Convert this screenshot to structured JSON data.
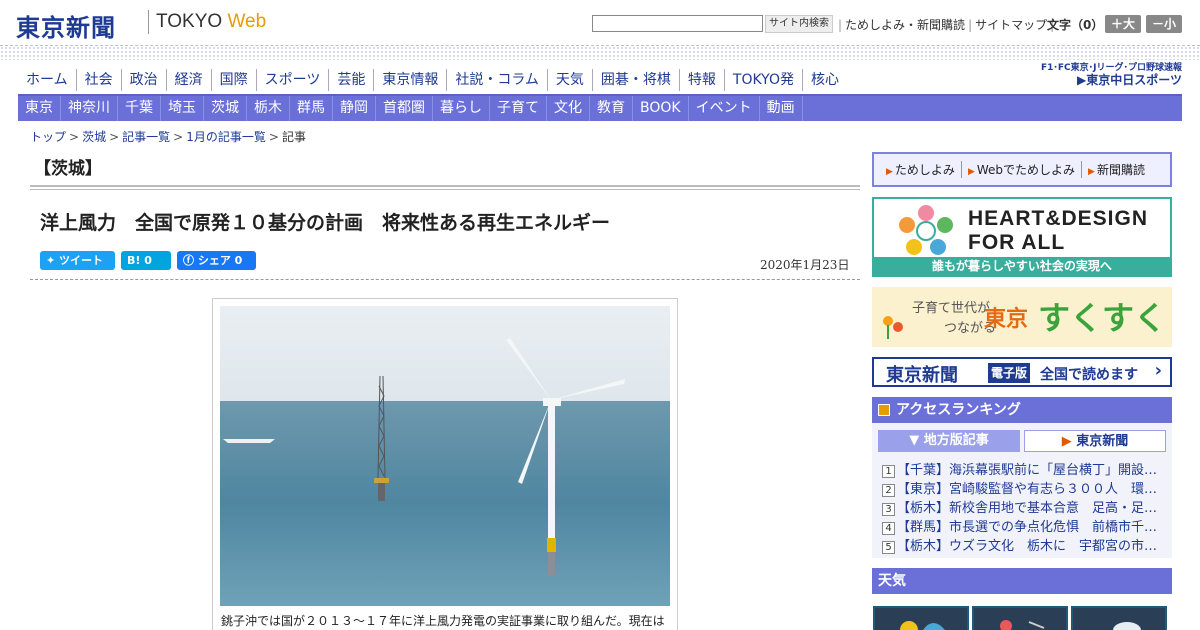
{
  "header": {
    "logo": "東京新聞",
    "logo_sub_a": "TOKYO ",
    "logo_sub_b": "Web",
    "search_button": "サイト内検索",
    "links": [
      "ためしよみ・新聞購読",
      "サイトマップ"
    ],
    "font_size_label": "文字（0）",
    "font_up": "＋大",
    "font_down": "－小"
  },
  "sponsor": {
    "line1": "F1･FC東京･Jリーグ･プロ野球速報",
    "line2": "▶東京中日スポーツ"
  },
  "main_nav": [
    "ホーム",
    "社会",
    "政治",
    "経済",
    "国際",
    "スポーツ",
    "芸能",
    "東京情報",
    "社説・コラム",
    "天気",
    "囲碁・将棋",
    "特報",
    "TOKYO発",
    "核心"
  ],
  "sub_nav": [
    "東京",
    "神奈川",
    "千葉",
    "埼玉",
    "茨城",
    "栃木",
    "群馬",
    "静岡",
    "首都圏",
    "暮らし",
    "子育て",
    "文化",
    "教育",
    "BOOK",
    "イベント",
    "動画"
  ],
  "breadcrumb": {
    "items": [
      "トップ",
      "茨城",
      "記事一覧",
      "1月の記事一覧"
    ],
    "current": "記事"
  },
  "article": {
    "region": "【茨城】",
    "title": "洋上風力　全国で原発１０基分の計画　将来性ある再生エネルギー",
    "date": "2020年1月23日",
    "caption": "銚子沖では国が２０１３～１７年に洋上風力発電の実証事業に取り組んだ。現在は"
  },
  "share": {
    "tweet": "ツイート",
    "hatena": "B! 0",
    "facebook": "シェア 0"
  },
  "sidebar": {
    "quick_links": [
      "ためしよみ",
      "Webでためしよみ",
      "新聞購読"
    ],
    "heart_line1": "HEART&DESIGN",
    "heart_line2": "FOR ALL",
    "heart_bar": "誰もが暮らしやすい社会の実現へ",
    "suku_1": "子育て世代が",
    "suku_2": "つながる",
    "suku_3": "東京",
    "suku_4": "すくすく",
    "epaper_name": "東京新聞",
    "epaper_badge": "電子版",
    "epaper_text": "全国で読めます",
    "ranking_title": "アクセスランキング",
    "ranking_tabs": [
      "地方版記事",
      "東京新聞"
    ],
    "ranking": [
      "【千葉】海浜幕張駅前に「屋台横丁」開設…",
      "【東京】宮崎駿監督や有志ら３００人　環…",
      "【栃木】新校舎用地で基本合意　足高・足…",
      "【群馬】市長選での争点化危惧　前橋市千…",
      "【栃木】ウズラ文化　栃木に　宇都宮の市…"
    ],
    "weather_title": "天気"
  },
  "colors": {
    "brand": "#1f3a93",
    "nav": "#6a70d8",
    "accent": "#e89c00"
  }
}
